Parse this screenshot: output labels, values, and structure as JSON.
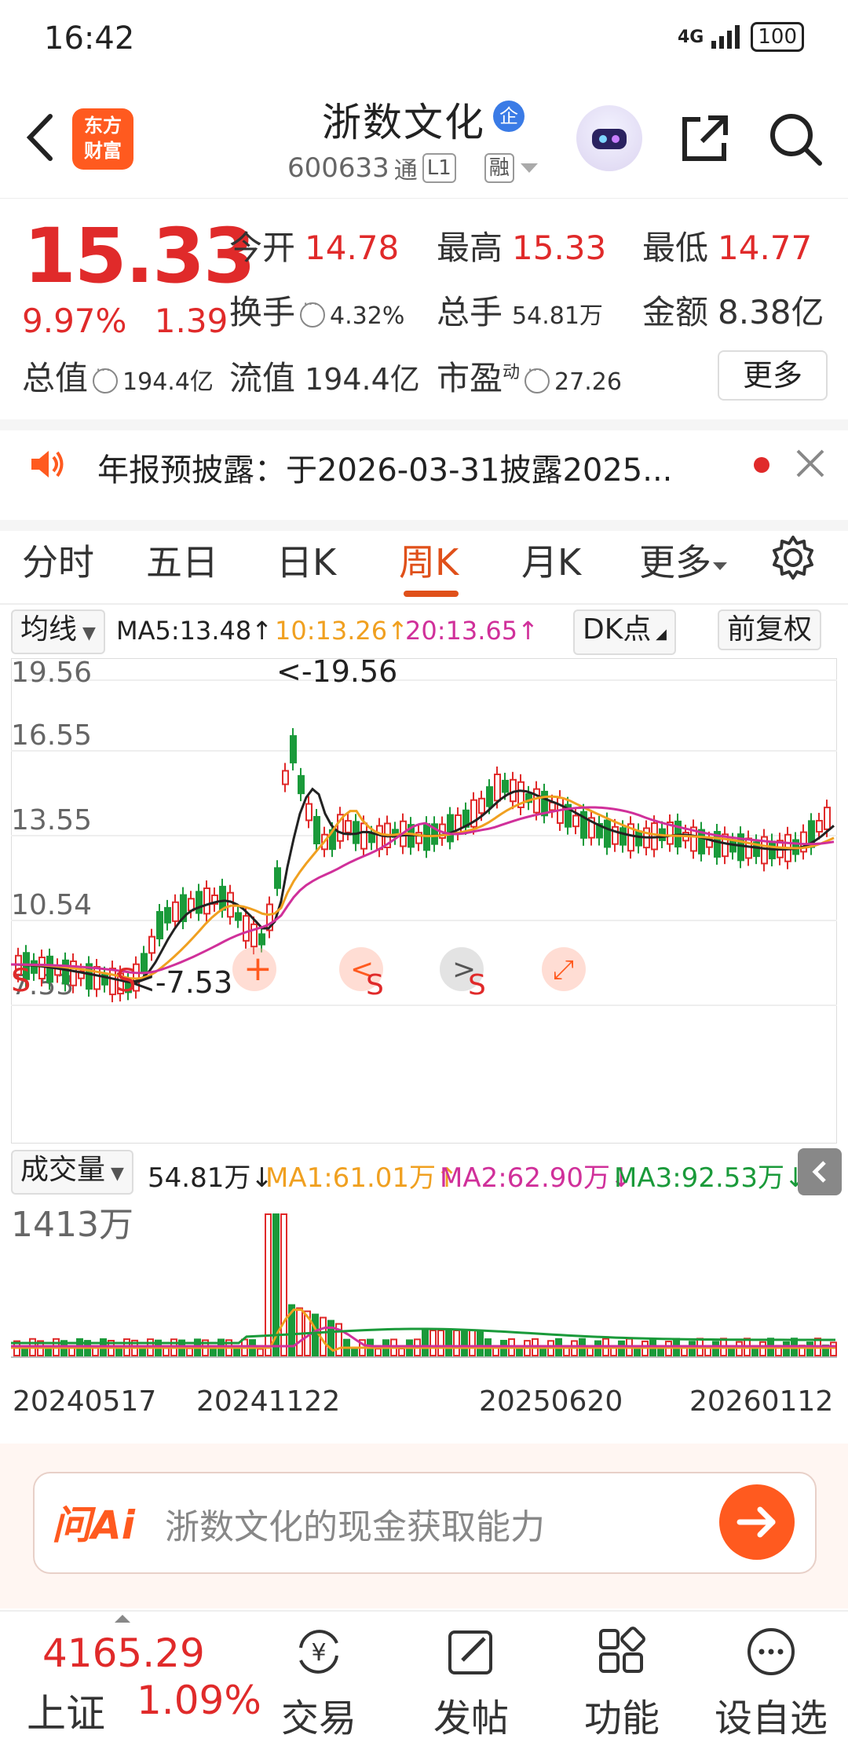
{
  "status": {
    "time": "16:42",
    "network": "4G",
    "battery": "100"
  },
  "header": {
    "logo_line1": "东方",
    "logo_line2": "财富",
    "stock_name": "浙数文化",
    "badge": "企",
    "stock_code": "600633",
    "tag_tong": "通",
    "tag_level": "L1",
    "tag_rong": "融"
  },
  "quote": {
    "price": "15.33",
    "change_pct": "9.97%",
    "change_amt": "1.39",
    "open_label": "今开",
    "open": "14.78",
    "high_label": "最高",
    "high": "15.33",
    "low_label": "最低",
    "low": "14.77",
    "turnover_label": "换手",
    "turnover": "4.32%",
    "volume_label": "总手",
    "volume": "54.81万",
    "amount_label": "金额",
    "amount": "8.38亿",
    "mktcap_label": "总值",
    "mktcap": "194.4亿",
    "float_label": "流值",
    "float": "194.4亿",
    "pe_label": "市盈",
    "pe_sup": "动",
    "pe": "27.26",
    "more": "更多"
  },
  "notice": {
    "text": "年报预披露：于2026-03-31披露2025..."
  },
  "tabs": [
    "分时",
    "五日",
    "日K",
    "周K",
    "月K",
    "更多"
  ],
  "active_tab": "周K",
  "ma": {
    "selector": "均线",
    "ma5": "MA5:13.48↑",
    "ma10": "10:13.26↑",
    "ma20": "20:13.65↑",
    "dk": "DK点",
    "fq": "前复权"
  },
  "kline": {
    "y_labels": [
      "19.56",
      "16.55",
      "13.55",
      "10.54",
      "7.53"
    ],
    "max_label": "<-19.56",
    "min_label": "<-7.53",
    "signal": "S"
  },
  "volume": {
    "selector": "成交量",
    "current": "54.81万↓",
    "ma1": "MA1:61.01万↑",
    "ma2": "MA2:62.90万↓",
    "ma3": "MA3:92.53万↓",
    "max_label": "1413万"
  },
  "dates": [
    "20240517",
    "20241122",
    "20250620",
    "20260112"
  ],
  "ai": {
    "logo": "问Ai",
    "prompt": "浙数文化的现金获取能力"
  },
  "index": {
    "value": "4165.29",
    "name": "上证",
    "change": "1.09%"
  },
  "nav": [
    "交易",
    "发帖",
    "功能",
    "设自选"
  ],
  "colors": {
    "up": "#e02a2a",
    "down": "#1a9a3a",
    "ma5": "#222222",
    "ma10": "#f0a020",
    "ma20": "#d0309a",
    "accent": "#ff5a1f"
  }
}
